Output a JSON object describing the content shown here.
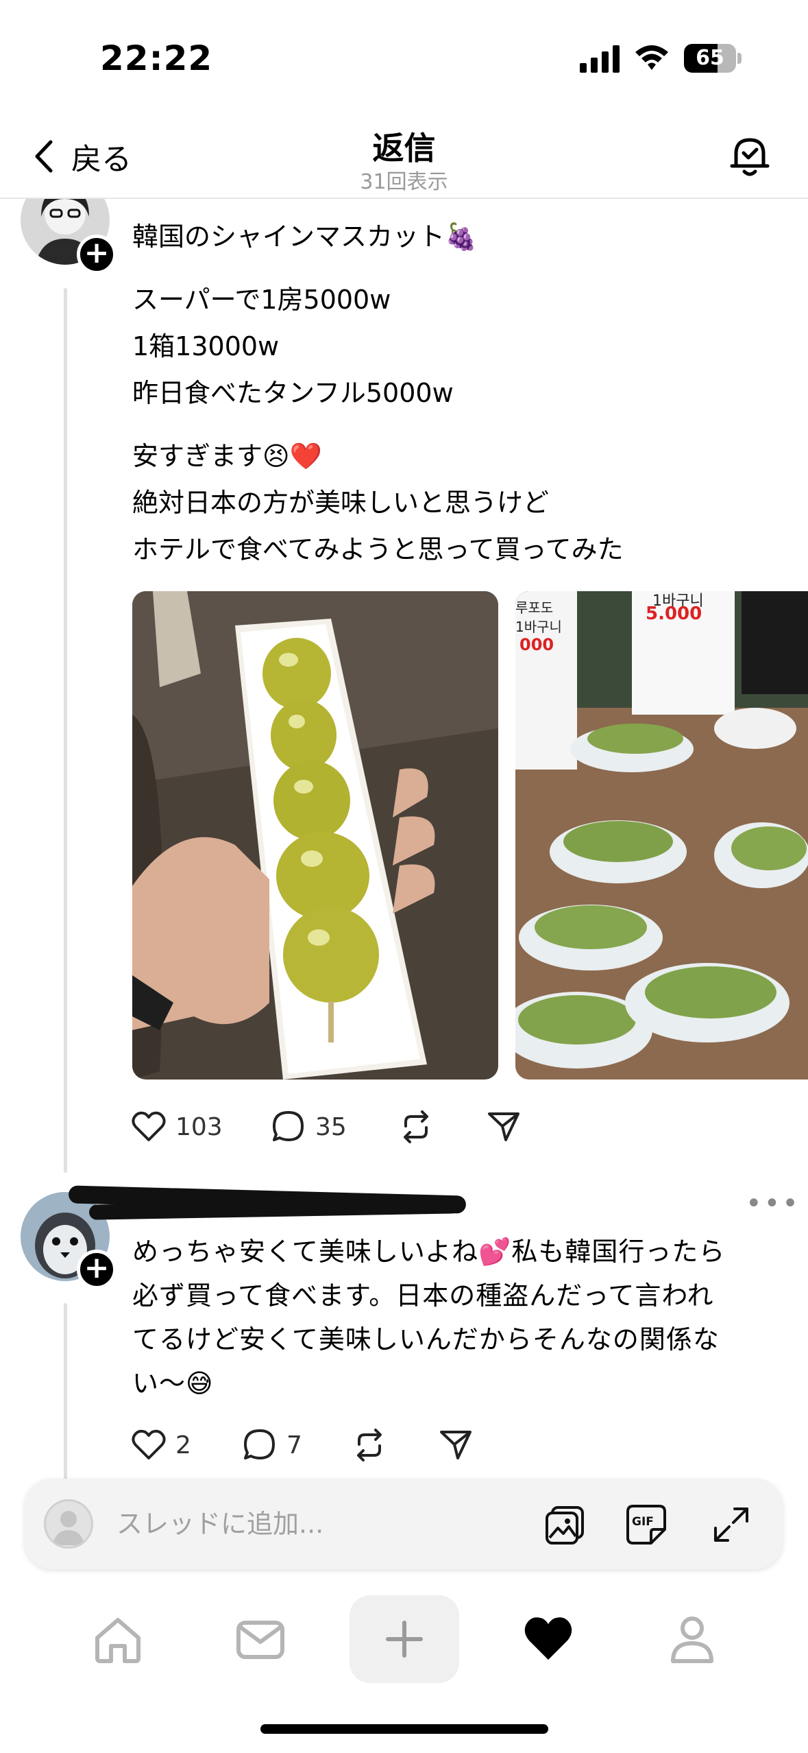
{
  "status_bar": {
    "time": "22:22",
    "battery": "65",
    "battery_level": 0.65
  },
  "header": {
    "back_label": "戻る",
    "title": "返信",
    "view_count": "31回表示"
  },
  "post1": {
    "lines": [
      "韓国のシャインマスカット🍇",
      "スーパーで1房5000w",
      "1箱13000w",
      "昨日食べたタンフル5000w",
      "安すぎます😣❤️",
      "絶対日本の方が美味しいと思うけど",
      "ホテルで食べてみようと思って買ってみた"
    ],
    "photo_texts": [
      "1바구니",
      "5.000",
      "루포도",
      "1바구니",
      "000"
    ],
    "likes": "103",
    "replies": "35"
  },
  "post2": {
    "lines": [
      "めっちゃ安くて美味しいよね💕私も韓国行ったら",
      "必ず買って食べます。日本の種盗んだって言われ",
      "てるけど安くて美味しいんだからそんなの関係な",
      "い〜😅"
    ],
    "likes": "2",
    "replies": "7"
  },
  "composer": {
    "placeholder": "スレッドに追加..."
  },
  "icons": {
    "header": [
      "back-chevron-icon",
      "notification-bell-icon"
    ],
    "actions": [
      "heart-icon",
      "comment-icon",
      "repost-icon",
      "share-icon"
    ],
    "composer": [
      "image-icon",
      "gif-icon",
      "expand-icon"
    ],
    "tabs": [
      "home-icon",
      "inbox-icon",
      "plus-icon",
      "heart-filled-icon",
      "profile-icon"
    ]
  }
}
